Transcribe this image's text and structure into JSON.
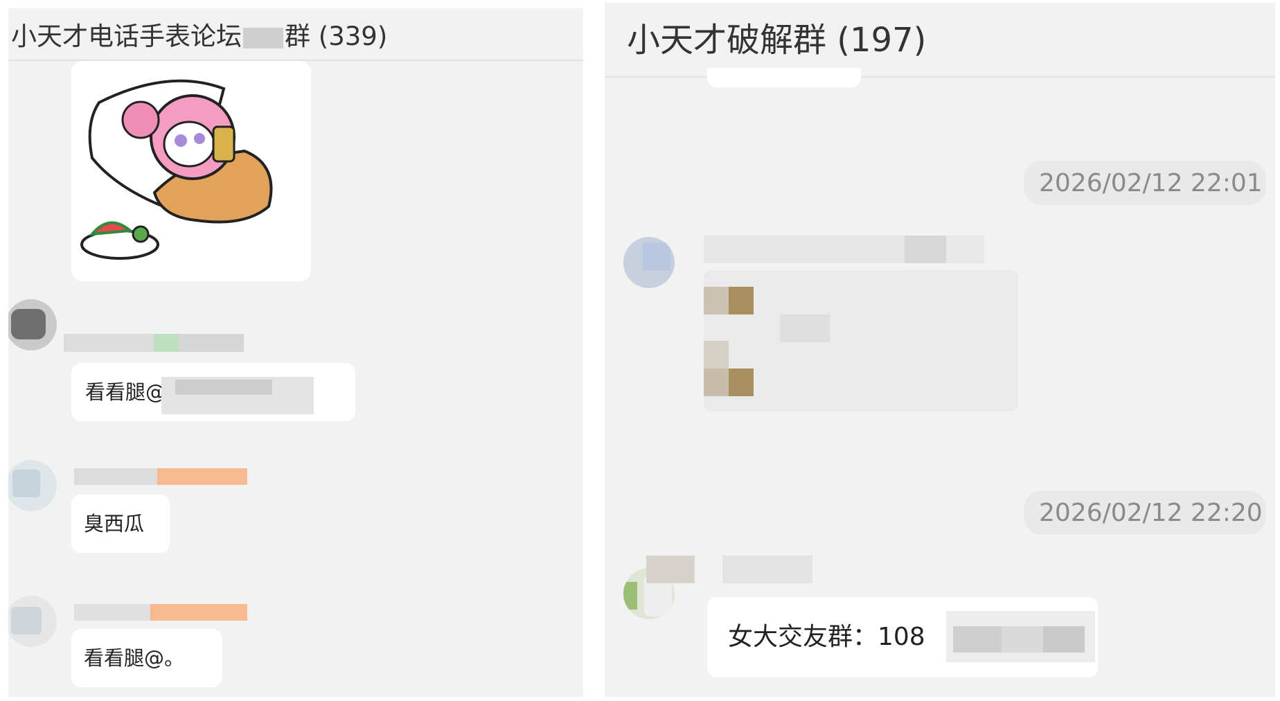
{
  "left_panel": {
    "title": "小天才电话手表论坛",
    "title_suffix": "群 (339)",
    "messages": [
      {
        "text": "看看腿@"
      },
      {
        "text": "臭西瓜"
      },
      {
        "text": "看看腿@。"
      }
    ]
  },
  "right_panel": {
    "title": "小天才破解群 (197)",
    "timestamp_1": "2026/02/12 22:01",
    "timestamp_2": "2026/02/12 22:20",
    "message_last": "女大交友群：108"
  },
  "colors": {
    "panel_bg": "#f2f2f2",
    "bubble_bg": "#ffffff",
    "timestamp_bg": "#e9e9e9",
    "timestamp_text": "#8a8a8a"
  }
}
